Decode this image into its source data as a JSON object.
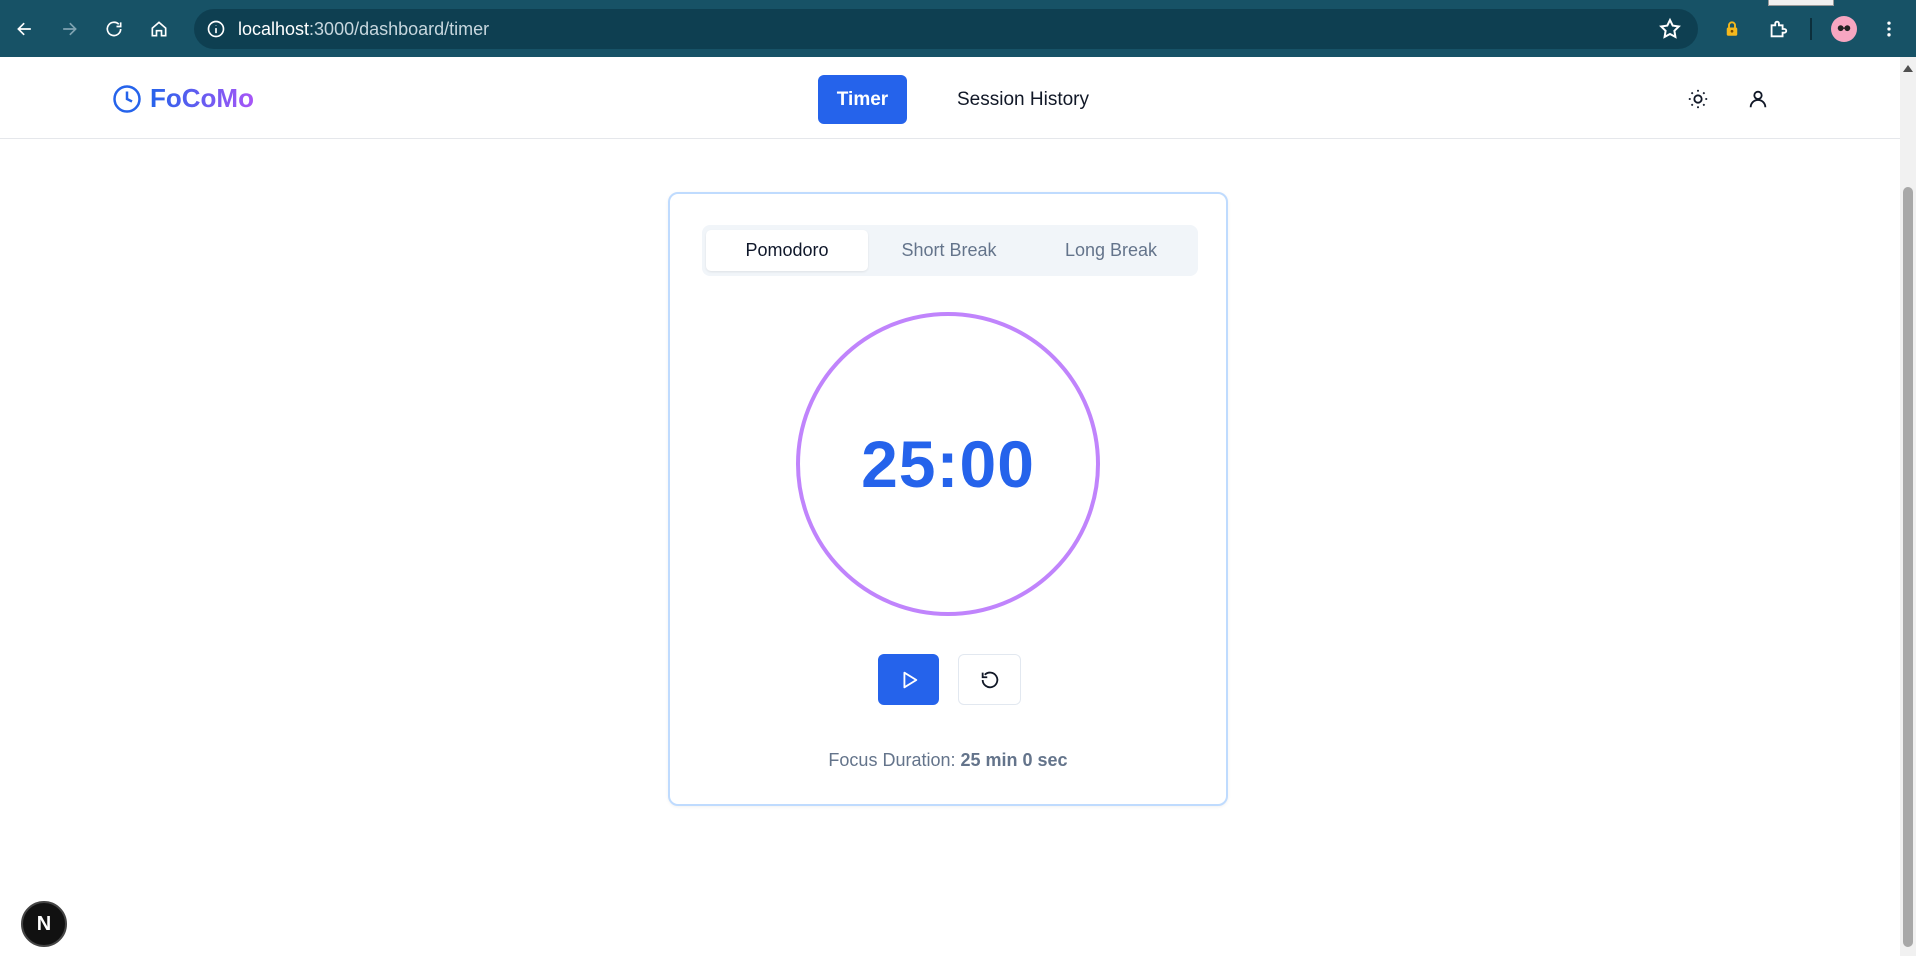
{
  "browser": {
    "url_host": "localhost",
    "url_path": ":3000/dashboard/timer"
  },
  "header": {
    "logo_text": "FoCoMo",
    "nav": {
      "timer_label": "Timer",
      "history_label": "Session History"
    }
  },
  "timer": {
    "modes": [
      "Pomodoro",
      "Short Break",
      "Long Break"
    ],
    "active_mode": "Pomodoro",
    "display": "25:00",
    "duration_label": "Focus Duration:",
    "duration_value": "25 min 0 sec"
  },
  "colors": {
    "primary": "#2563eb",
    "ring": "#c084fc",
    "card_border": "#bfdbfe",
    "browser_bar": "#175266"
  },
  "icons": {
    "logo": "clock-icon",
    "theme": "sun-icon",
    "account": "user-icon",
    "play": "play-icon",
    "reset": "rotate-ccw-icon"
  },
  "dev_badge": "N"
}
